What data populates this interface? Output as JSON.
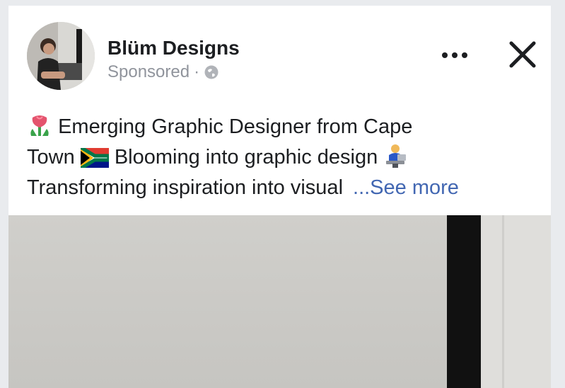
{
  "post": {
    "page_name": "Blüm Designs",
    "sponsored_label": "Sponsored",
    "separator": "·",
    "lines": {
      "l1": "Emerging Graphic Designer from Cape",
      "l2a": "Town",
      "l2b": "Blooming into graphic design",
      "l3": "Transforming inspiration into visual"
    },
    "see_more": "...See more"
  },
  "icons": {
    "flower": "tulip-emoji",
    "flag": "south-africa-flag-emoji",
    "person": "person-at-desk-emoji",
    "globe": "globe-icon",
    "more": "more-horizontal-icon",
    "close": "close-icon"
  },
  "colors": {
    "link": "#4267b2",
    "text": "#1c1e21",
    "muted": "#90949c"
  }
}
